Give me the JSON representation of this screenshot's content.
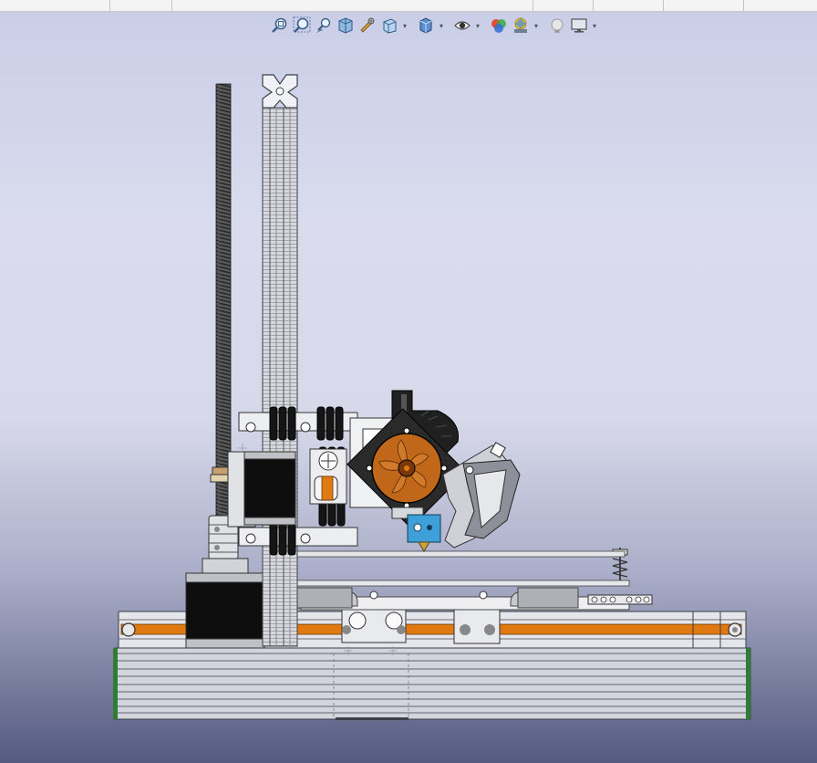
{
  "app": {
    "window": "CAD 3D viewport"
  },
  "toolbar": {
    "items": [
      {
        "icon": "zoom-to-fit-icon",
        "has_dropdown": false
      },
      {
        "icon": "zoom-to-area-icon",
        "has_dropdown": false
      },
      {
        "icon": "previous-view-icon",
        "has_dropdown": false
      },
      {
        "icon": "section-view-icon",
        "has_dropdown": false
      },
      {
        "icon": "dynamic-annotation-icon",
        "has_dropdown": false
      },
      {
        "icon": "view-orientation-icon",
        "has_dropdown": true
      },
      {
        "icon": "display-style-icon",
        "has_dropdown": true
      },
      {
        "icon": "hide-show-items-icon",
        "has_dropdown": true
      },
      {
        "icon": "edit-appearance-icon",
        "has_dropdown": false
      },
      {
        "icon": "apply-scene-icon",
        "has_dropdown": true
      },
      {
        "icon": "view-settings-icon",
        "has_dropdown": false
      },
      {
        "icon": "display-monitor-icon",
        "has_dropdown": true
      }
    ]
  },
  "colors": {
    "frame": "#c8cbd2",
    "frame_dark": "#7e828c",
    "belt": "#e07a10",
    "fan": "#c0671a",
    "motor": "#0e0e0e",
    "heater_block": "#3ea0d8",
    "edge_green": "#2f7d34"
  }
}
